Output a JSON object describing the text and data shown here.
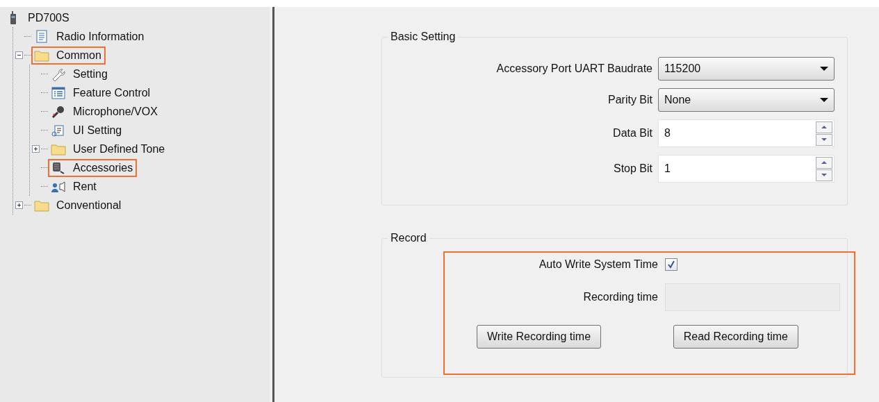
{
  "tree": {
    "label": "PD700S",
    "kind": "radio",
    "highlighted": false,
    "children": [
      {
        "label": "Radio Information",
        "kind": "document",
        "highlighted": false
      },
      {
        "label": "Common",
        "kind": "folder",
        "highlighted": true,
        "expanded": true,
        "children": [
          {
            "label": "Setting",
            "kind": "wrench",
            "highlighted": false
          },
          {
            "label": "Feature Control",
            "kind": "list",
            "highlighted": false
          },
          {
            "label": "Microphone/VOX",
            "kind": "microphone",
            "highlighted": false
          },
          {
            "label": "UI Setting",
            "kind": "ui",
            "highlighted": false
          },
          {
            "label": "User Defined Tone",
            "kind": "folder",
            "highlighted": false,
            "expanded": false
          },
          {
            "label": "Accessories",
            "kind": "accessory",
            "highlighted": true
          },
          {
            "label": "Rent",
            "kind": "person",
            "highlighted": false
          }
        ]
      },
      {
        "label": "Conventional",
        "kind": "folder",
        "highlighted": false,
        "expanded": false
      }
    ]
  },
  "basic_setting": {
    "title": "Basic Setting",
    "fields": [
      {
        "kind": "dropdown",
        "label": "Accessory Port UART Baudrate",
        "value": "115200"
      },
      {
        "kind": "dropdown",
        "label": "Parity Bit",
        "value": "None"
      },
      {
        "kind": "spin",
        "label": "Data Bit",
        "value": "8"
      },
      {
        "kind": "spin",
        "label": "Stop Bit",
        "value": "1"
      }
    ]
  },
  "record": {
    "title": "Record",
    "highlighted": true,
    "auto_write": {
      "label": "Auto Write System Time",
      "checked": true
    },
    "recording_time": {
      "label": "Recording time",
      "disabled": true
    },
    "buttons": [
      "Write Recording time",
      "Read Recording time"
    ]
  }
}
